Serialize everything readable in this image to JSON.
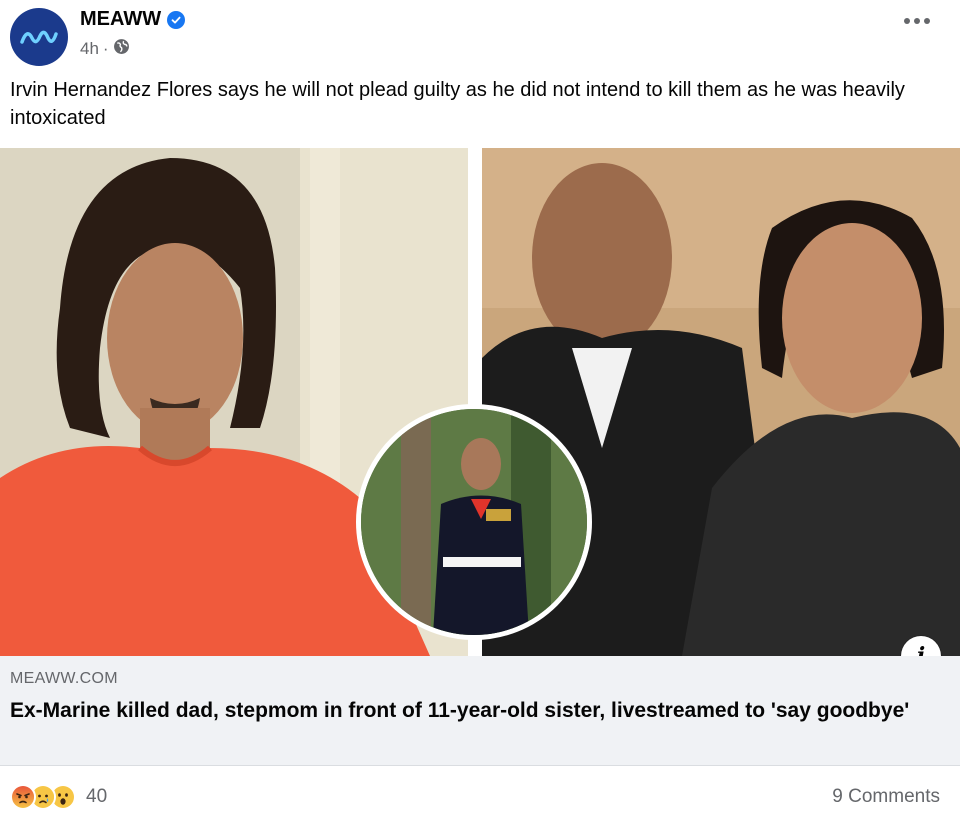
{
  "post": {
    "page_name": "MEAWW",
    "time": "4h",
    "separator": "·",
    "caption": "Irvin Hernandez Flores says he will not plead guilty as he did not intend to kill them as he was heavily intoxicated"
  },
  "link": {
    "domain": "MEAWW.COM",
    "title": "Ex-Marine killed dad, stepmom in front of 11-year-old sister, livestreamed to 'say goodbye'",
    "info_glyph": "i"
  },
  "footer": {
    "reaction_count": "40",
    "comments": "9 Comments"
  },
  "colors": {
    "brand_avatar": "#1b3a8c",
    "verified": "#1877f2",
    "secondary_text": "#65676b",
    "card_bg": "#f0f2f5"
  },
  "icons": [
    "meaww-logo",
    "verified-badge-icon",
    "globe-icon",
    "more-options-icon",
    "info-icon",
    "angry-reaction-icon",
    "sad-reaction-icon",
    "wow-reaction-icon"
  ]
}
